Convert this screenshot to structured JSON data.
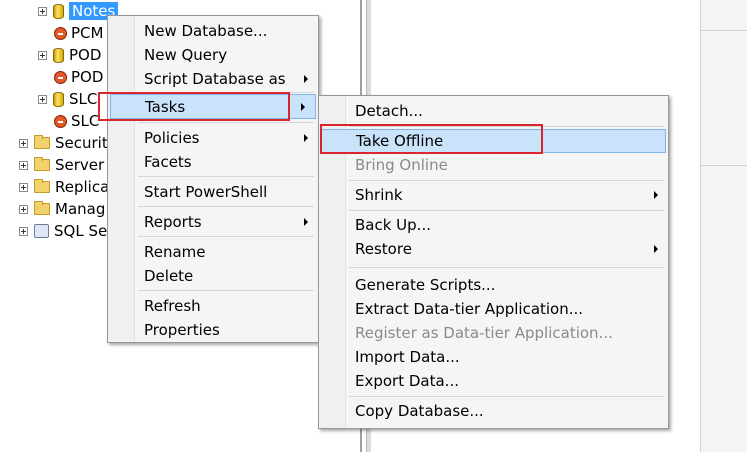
{
  "tree": {
    "nodes": [
      {
        "label": "Notes",
        "icon": "database-icon"
      },
      {
        "label": "PCM",
        "icon": "database-offline-icon"
      },
      {
        "label": "POD",
        "icon": "database-icon"
      },
      {
        "label": "POD",
        "icon": "database-offline-icon"
      },
      {
        "label": "SLC",
        "icon": "database-icon"
      },
      {
        "label": "SLC",
        "icon": "database-offline-icon"
      },
      {
        "label": "Securit",
        "icon": "folder-icon"
      },
      {
        "label": "Server",
        "icon": "folder-icon"
      },
      {
        "label": "Replica",
        "icon": "folder-icon"
      },
      {
        "label": "Manag",
        "icon": "folder-icon"
      },
      {
        "label": "SQL Se",
        "icon": "sql-agent-icon"
      }
    ]
  },
  "context_menu": {
    "items": {
      "new_database": "New Database...",
      "new_query": "New Query",
      "script_database_as": "Script Database as",
      "tasks": "Tasks",
      "policies": "Policies",
      "facets": "Facets",
      "start_powershell": "Start PowerShell",
      "reports": "Reports",
      "rename": "Rename",
      "delete": "Delete",
      "refresh": "Refresh",
      "properties": "Properties"
    }
  },
  "tasks_menu": {
    "items": {
      "detach": "Detach...",
      "take_offline": "Take Offline",
      "bring_online": "Bring Online",
      "shrink": "Shrink",
      "back_up": "Back Up...",
      "restore": "Restore",
      "generate_scripts": "Generate Scripts...",
      "extract_data_tier": "Extract Data-tier Application...",
      "register_data_tier": "Register as Data-tier Application...",
      "import_data": "Import Data...",
      "export_data": "Export Data...",
      "copy_database": "Copy Database..."
    }
  },
  "colors": {
    "highlight": "#c9e3fb",
    "annotation_box": "#d9252b",
    "selection": "#3399ff"
  }
}
